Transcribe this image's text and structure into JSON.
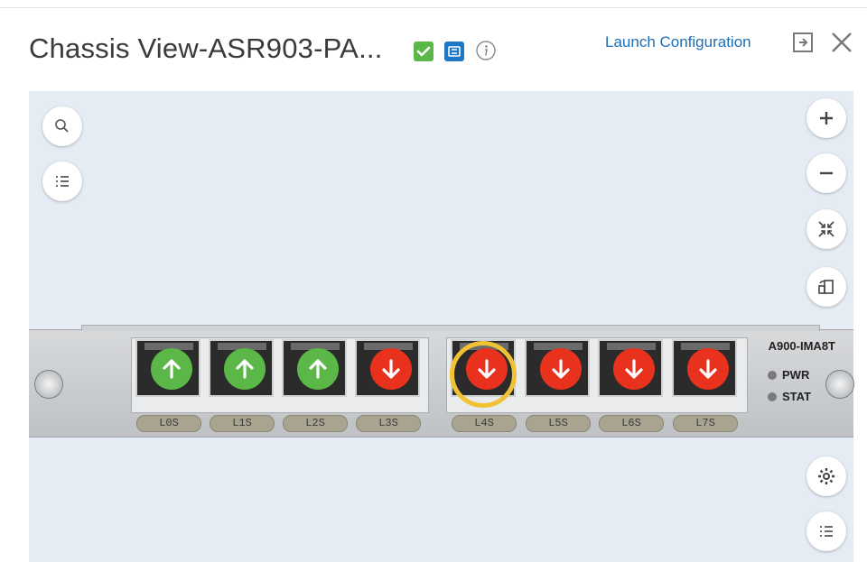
{
  "header": {
    "title": "Chassis View-ASR903-PA...",
    "launch_label": "Launch Configuration"
  },
  "icons": {
    "status": "check-icon",
    "network": "network-icon",
    "info": "info-icon",
    "expand": "expand-panel-icon",
    "close": "close-icon"
  },
  "toolbar_left": [
    "search-icon",
    "list-icon"
  ],
  "toolbar_right": [
    "zoom-in-icon",
    "zoom-out-icon",
    "fit-icon",
    "rotate-icon"
  ],
  "toolbar_bottom": [
    "settings-icon",
    "list-icon"
  ],
  "module": {
    "model": "A900-IMA8T",
    "leds": [
      {
        "label": "PWR"
      },
      {
        "label": "STAT"
      }
    ],
    "ports": [
      {
        "label": "L0S",
        "status": "up"
      },
      {
        "label": "L1S",
        "status": "up"
      },
      {
        "label": "L2S",
        "status": "up"
      },
      {
        "label": "L3S",
        "status": "down"
      },
      {
        "label": "L4S",
        "status": "down",
        "selected": true
      },
      {
        "label": "L5S",
        "status": "down"
      },
      {
        "label": "L6S",
        "status": "down"
      },
      {
        "label": "L7S",
        "status": "down"
      }
    ]
  },
  "colors": {
    "up": "#5bb748",
    "down": "#e8321e",
    "selected_ring": "#f0c234",
    "link": "#1e6fb4",
    "canvas": "#e5ecf4"
  }
}
